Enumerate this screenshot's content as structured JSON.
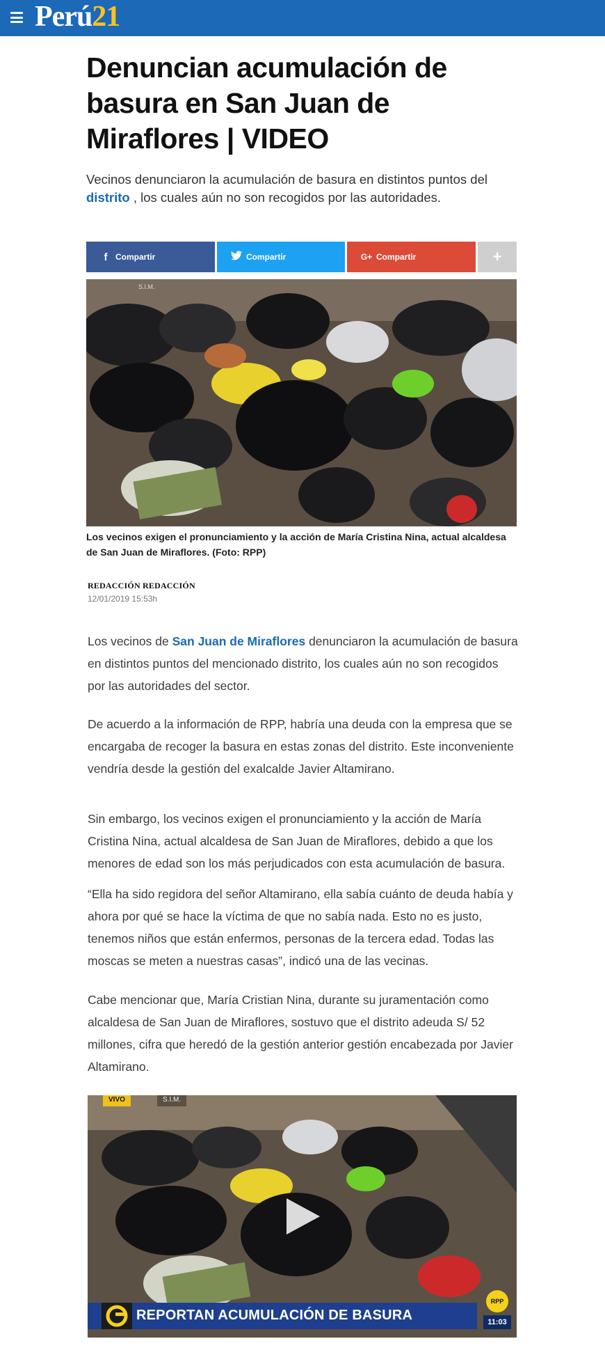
{
  "header": {
    "logo_word": "Perú",
    "logo_number": "21",
    "colors": {
      "bar": "#1b69b7",
      "logo_number": "#ffc220"
    }
  },
  "article": {
    "title": "Denuncian acumulación de basura en San Juan de Miraflores | VIDEO",
    "subtitle_before": "Vecinos denunciaron la acumulación de basura en distintos puntos del",
    "subtitle_link": "distrito",
    "subtitle_after": " , los cuales aún no son recogidos por las autoridades.",
    "share": {
      "facebook": "Compartir",
      "twitter": "Compartir",
      "google": "Compartir",
      "more": "+"
    },
    "photo_overlay": "S.I.M.",
    "caption": "Los vecinos exigen el pronunciamiento y la acción de María Cristina Nina, actual alcaldesa de San Juan de Miraflores. (Foto: RPP)",
    "author": "REDACCIÓN REDACCIÓN",
    "date": "12/01/2019 15:53h",
    "p1_before": "Los vecinos de ",
    "p1_link": "San Juan de Miraflores",
    "p1_after": " denunciaron la acumulación de basura en distintos puntos del mencionado distrito, los cuales aún no son recogidos por las autoridades del sector.",
    "p2": "De acuerdo a la información de RPP, habría una deuda con la empresa que se encargaba de recoger la basura en estas zonas del distrito. Este inconveniente vendría desde la gestión del exalcalde Javier Altamirano.",
    "p3": "Sin embargo, los vecinos exigen el pronunciamiento y la acción de María Cristina Nina, actual alcaldesa de San Juan de Miraflores, debido a que los menores de edad son los más perjudicados con esta acumulación de basura.",
    "p4": "“Ella ha sido regidora del señor Altamirano, ella sabía cuánto de deuda había y ahora por qué se hace la víctima de que no sabía nada. Esto no es justo, tenemos niños que están enfermos, personas de la tercera edad. Todas las moscas se meten a nuestras casas”, indicó una de las vecinas.",
    "p5": "Cabe mencionar que, María Cristian Nina, durante su juramentación como alcaldesa de San Juan de Miraflores, sostuvo que el distrito adeuda S/ 52 millones, cifra que heredó de la gestión anterior gestión encabezada por Javier Altamirano.",
    "video": {
      "live_tag": "VIVO",
      "overlay": "S.I.M.",
      "banner": "REPORTAN ACUMULACIÓN DE BASURA",
      "channel": "RPP",
      "time": "11:03"
    }
  }
}
